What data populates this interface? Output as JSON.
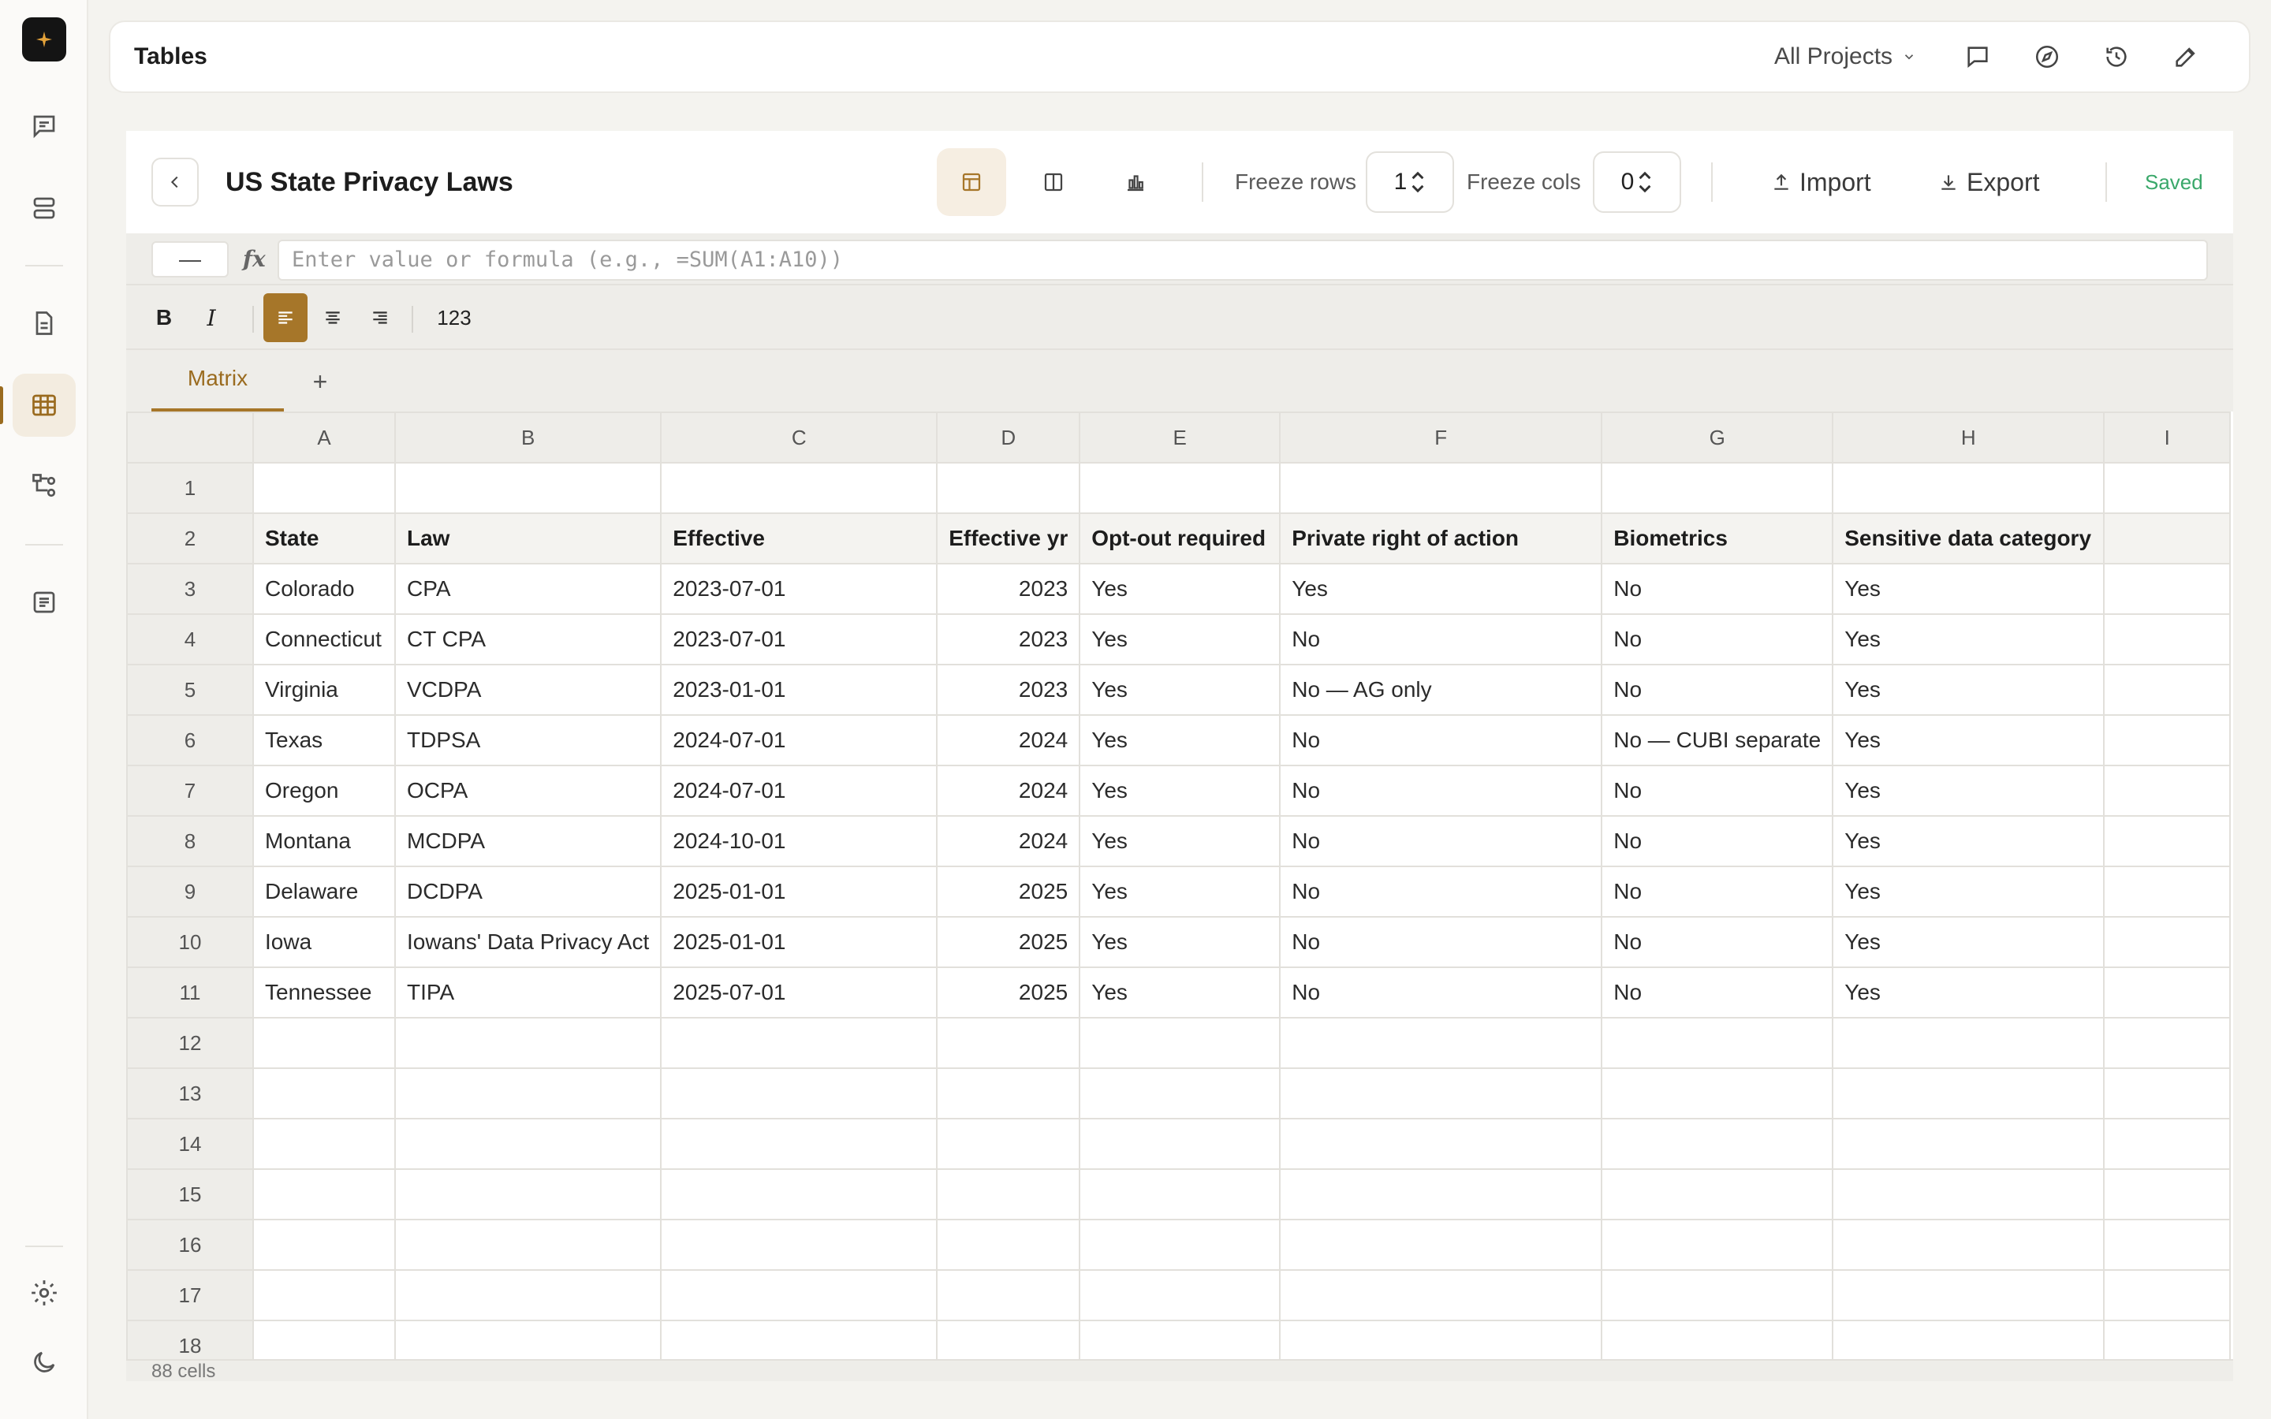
{
  "app": {
    "title": "Tables",
    "project_selector": "All Projects"
  },
  "sidebar": {
    "items": [
      {
        "icon": "chat-icon"
      },
      {
        "icon": "database-icon"
      },
      {
        "icon": "document-icon"
      },
      {
        "icon": "table-icon",
        "active": true
      },
      {
        "icon": "workflow-icon"
      },
      {
        "icon": "notes-icon"
      }
    ],
    "bottom": [
      {
        "icon": "gear-icon"
      },
      {
        "icon": "moon-icon"
      }
    ]
  },
  "doc": {
    "title": "US State Privacy Laws",
    "status": "Saved"
  },
  "toolbar": {
    "freeze_rows_label": "Freeze rows",
    "freeze_rows_value": "1",
    "freeze_cols_label": "Freeze cols",
    "freeze_cols_value": "0",
    "import_label": "Import",
    "export_label": "Export"
  },
  "formula": {
    "cell_ref": "—",
    "fx": "fx",
    "placeholder": "Enter value or formula (e.g., =SUM(A1:A10))"
  },
  "format": {
    "bold": "B",
    "italic": "I",
    "number": "123"
  },
  "sheet_tabs": [
    {
      "label": "Matrix",
      "active": true
    }
  ],
  "add_tab": "+",
  "grid": {
    "columns": [
      "A",
      "B",
      "C",
      "D",
      "E",
      "F",
      "G",
      "H",
      "I"
    ],
    "rows": [
      [
        "",
        "",
        "",
        "",
        "",
        "",
        "",
        "",
        ""
      ],
      [
        "State",
        "Law",
        "Effective",
        "Effective yr",
        "Opt-out required",
        "Private right of action",
        "Biometrics",
        "Sensitive data category",
        ""
      ],
      [
        "Colorado",
        "CPA",
        "2023-07-01",
        "2023",
        "Yes",
        "Yes",
        "No",
        "Yes",
        ""
      ],
      [
        "Connecticut",
        "CT CPA",
        "2023-07-01",
        "2023",
        "Yes",
        "No",
        "No",
        "Yes",
        ""
      ],
      [
        "Virginia",
        "VCDPA",
        "2023-01-01",
        "2023",
        "Yes",
        "No — AG only",
        "No",
        "Yes",
        ""
      ],
      [
        "Texas",
        "TDPSA",
        "2024-07-01",
        "2024",
        "Yes",
        "No",
        "No — CUBI separate",
        "Yes",
        ""
      ],
      [
        "Oregon",
        "OCPA",
        "2024-07-01",
        "2024",
        "Yes",
        "No",
        "No",
        "Yes",
        ""
      ],
      [
        "Montana",
        "MCDPA",
        "2024-10-01",
        "2024",
        "Yes",
        "No",
        "No",
        "Yes",
        ""
      ],
      [
        "Delaware",
        "DCDPA",
        "2025-01-01",
        "2025",
        "Yes",
        "No",
        "No",
        "Yes",
        ""
      ],
      [
        "Iowa",
        "Iowans' Data Privacy Act",
        "2025-01-01",
        "2025",
        "Yes",
        "No",
        "No",
        "Yes",
        ""
      ],
      [
        "Tennessee",
        "TIPA",
        "2025-07-01",
        "2025",
        "Yes",
        "No",
        "No",
        "Yes",
        ""
      ],
      [
        "",
        "",
        "",
        "",
        "",
        "",
        "",
        "",
        ""
      ],
      [
        "",
        "",
        "",
        "",
        "",
        "",
        "",
        "",
        ""
      ],
      [
        "",
        "",
        "",
        "",
        "",
        "",
        "",
        "",
        ""
      ],
      [
        "",
        "",
        "",
        "",
        "",
        "",
        "",
        "",
        ""
      ],
      [
        "",
        "",
        "",
        "",
        "",
        "",
        "",
        "",
        ""
      ],
      [
        "",
        "",
        "",
        "",
        "",
        "",
        "",
        "",
        ""
      ],
      [
        "",
        "",
        "",
        "",
        "",
        "",
        "",
        "",
        ""
      ]
    ]
  },
  "status": {
    "cell_count": "88 cells"
  },
  "colors": {
    "accent": "#a67629",
    "saved": "#3aa86a"
  }
}
